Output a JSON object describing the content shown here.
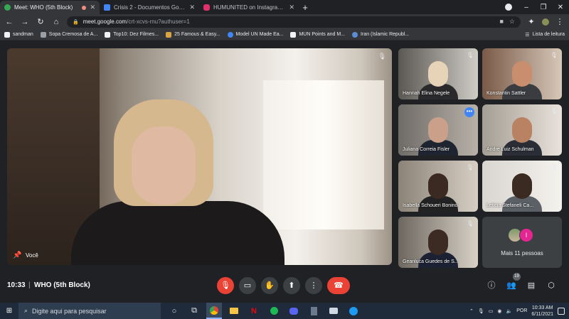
{
  "browser": {
    "tabs": [
      {
        "label": "Meet: WHO (5th Block)",
        "favicon_color": "#34a853",
        "active": true,
        "recording": true
      },
      {
        "label": "Crisis 2 - Documentos Google",
        "favicon_color": "#4285f4",
        "active": false
      },
      {
        "label": "HUMUNITED on Instagram: \"Sim",
        "favicon_color": "#e1306c",
        "active": false
      }
    ],
    "new_tab": "+",
    "url_host": "meet.google.com",
    "url_path": "/crt-xcvs-rnu?authuser=1",
    "bookmarks": [
      "sandman",
      "Sopa Cremosa de A...",
      "Top10: Dez Filmes...",
      "25 Famous & Easy...",
      "Model UN Made Ea...",
      "MUN Points and M...",
      "Iran (Islamic Republ..."
    ],
    "reading_list": "Lista de leitura"
  },
  "meet": {
    "self_label": "Você",
    "participants": [
      {
        "name": "Hannah Elina Negele",
        "mic_off": true
      },
      {
        "name": "Konstantin Sattler",
        "mic_off": true
      },
      {
        "name": "Juliana Correia Fisler",
        "mic_off": false,
        "speaking": true
      },
      {
        "name": "Andre Luiz Schulman",
        "mic_off": true
      },
      {
        "name": "Isabella Schoueri Bonino",
        "mic_off": true
      },
      {
        "name": "Leticia Stefaneli Ca...",
        "mic_off": true
      },
      {
        "name": "Geanluca Guedes de S...",
        "mic_off": true
      }
    ],
    "more_people_label": "Mais 11 pessoas",
    "more_people_initial": "I",
    "clock": "10:33",
    "divider": "|",
    "meeting_name": "WHO (5th Block)",
    "participants_count": "19"
  },
  "taskbar": {
    "search_placeholder": "Digite aqui para pesquisar",
    "language": "POR",
    "time": "10:33 AM",
    "date": "6/11/2021"
  },
  "colors": {
    "accent": "#8ab4f8",
    "end_call": "#ea4335",
    "more_avatar": "#e52592"
  }
}
